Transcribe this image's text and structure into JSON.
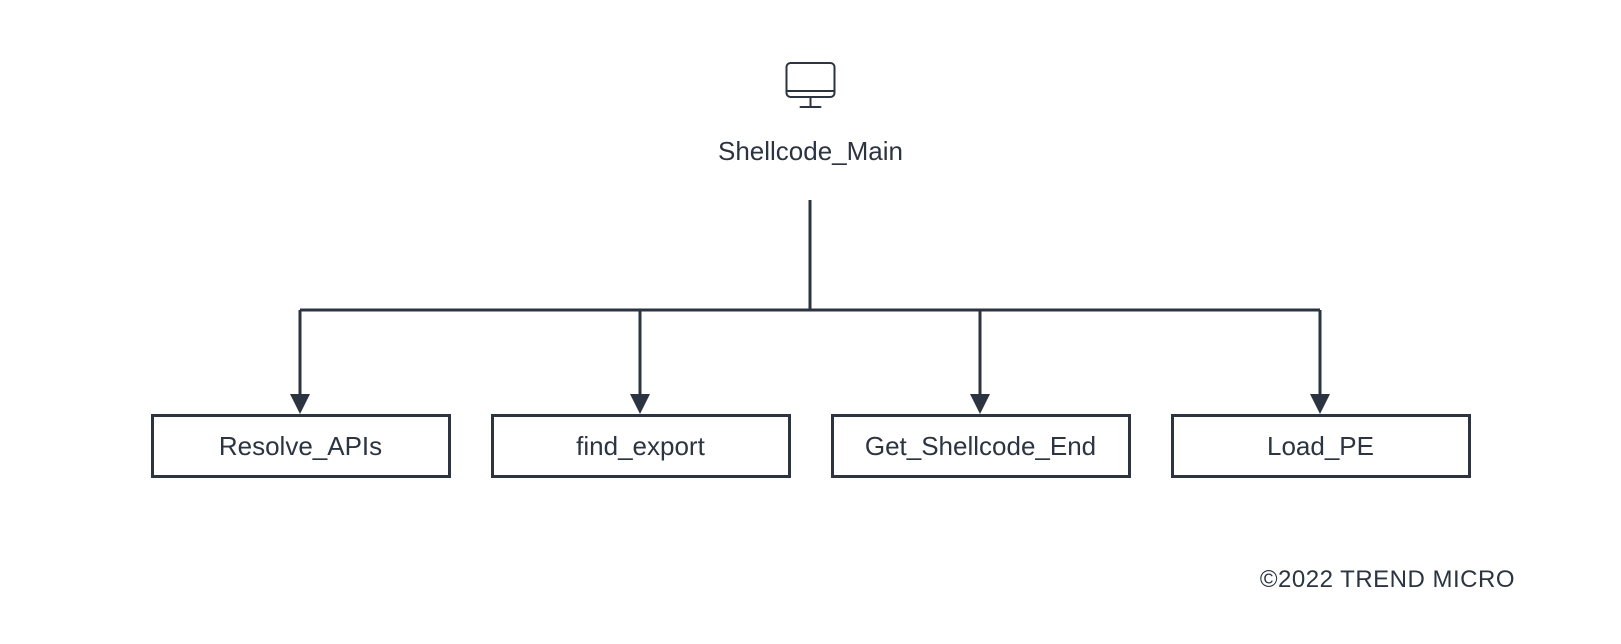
{
  "diagram": {
    "root": {
      "label": "Shellcode_Main",
      "icon": "monitor-icon"
    },
    "children": [
      {
        "label": "Resolve_APIs"
      },
      {
        "label": "find_export"
      },
      {
        "label": "Get_Shellcode_End"
      },
      {
        "label": "Load_PE"
      }
    ]
  },
  "copyright": "©2022 TREND MICRO"
}
